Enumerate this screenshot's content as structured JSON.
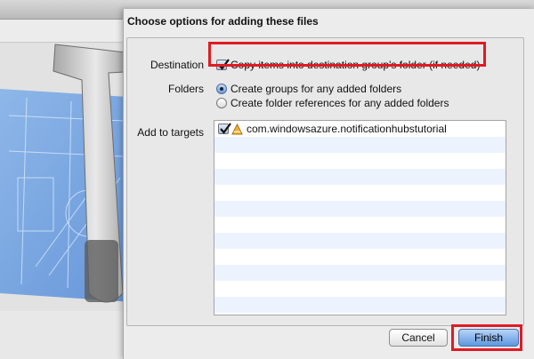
{
  "dialog": {
    "title": "Choose options for adding these files",
    "destination": {
      "label": "Destination",
      "checkbox_label": "Copy items into destination group's folder (if needed)",
      "checked": true
    },
    "folders": {
      "label": "Folders",
      "options": [
        {
          "label": "Create groups for any added folders",
          "selected": true
        },
        {
          "label": "Create folder references for any added folders",
          "selected": false
        }
      ]
    },
    "targets": {
      "label": "Add to targets",
      "items": [
        {
          "name": "com.windowsazure.notificationhubstutorial",
          "checked": true,
          "icon": "app-target-icon"
        }
      ]
    },
    "buttons": {
      "cancel": "Cancel",
      "finish": "Finish"
    }
  },
  "colors": {
    "highlight": "#e01b24",
    "primary_button": "#5d97e0",
    "list_stripe": "#edf3fe"
  }
}
